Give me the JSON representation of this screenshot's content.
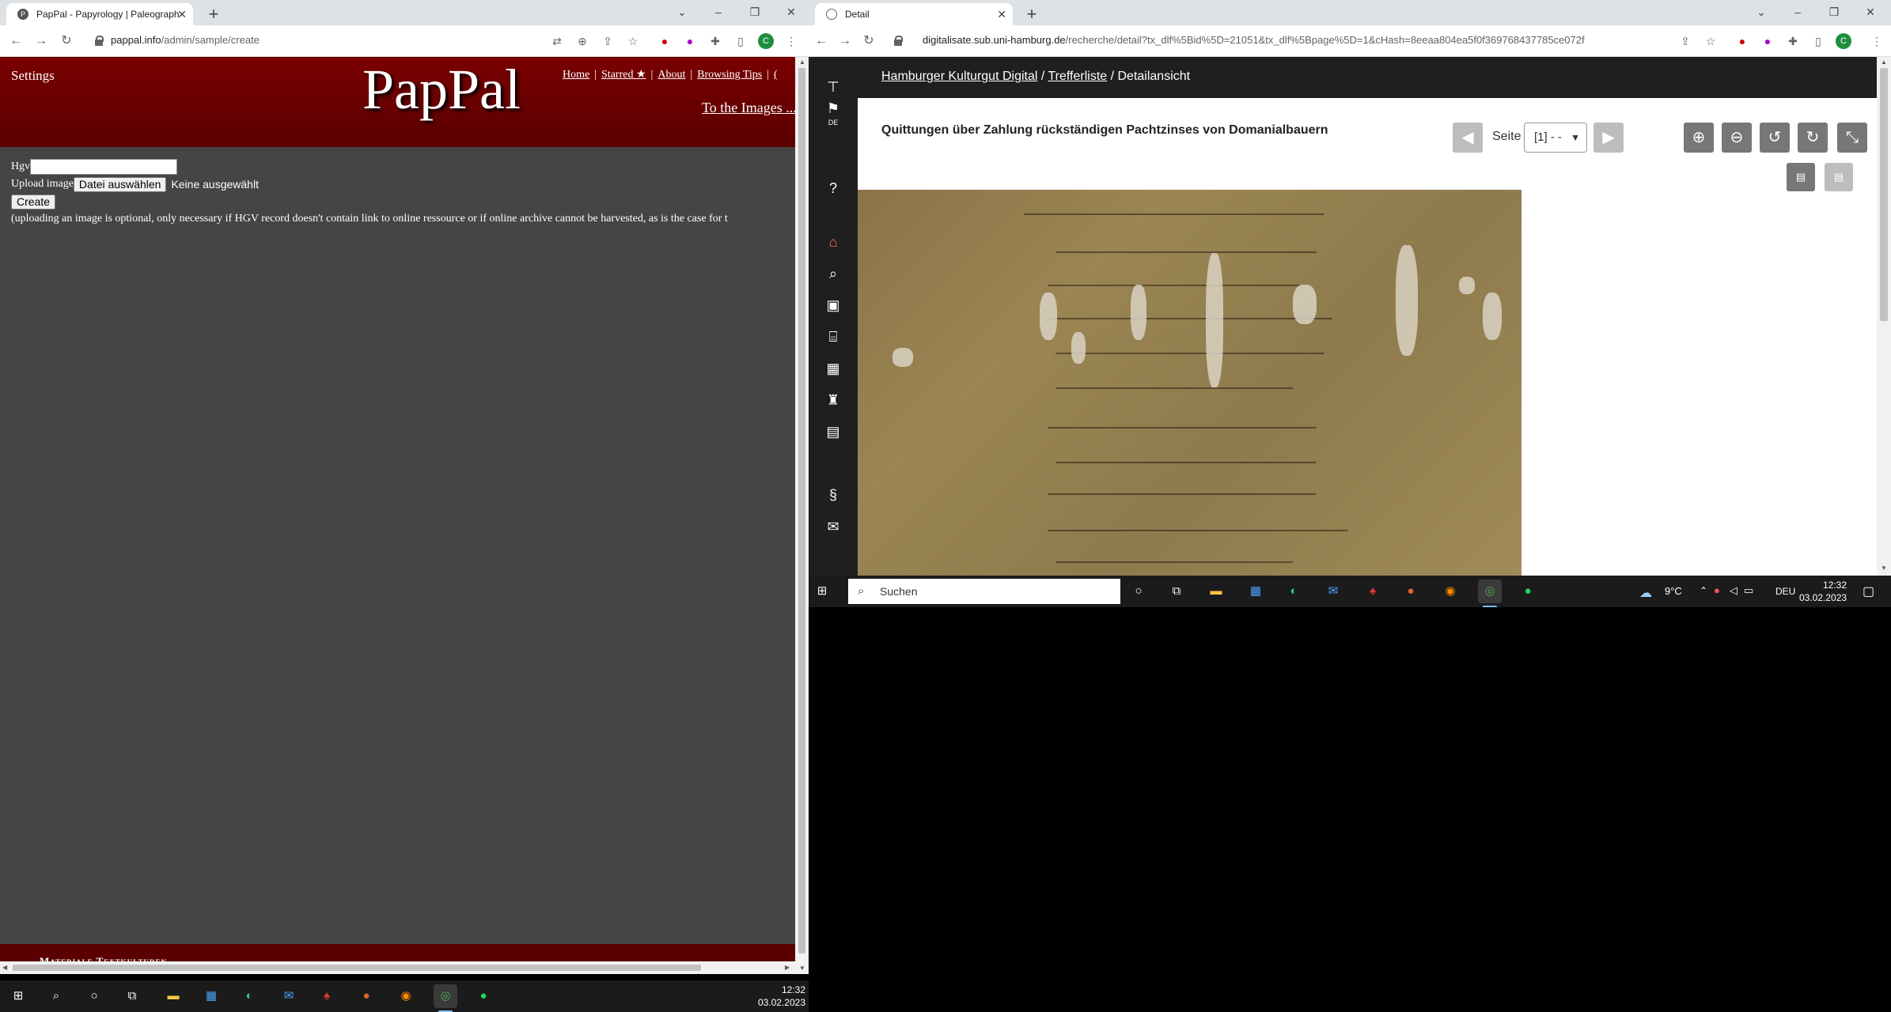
{
  "left_browser": {
    "tab_title": "PapPal - Papyrology | Paleograph",
    "favicon_letter": "P",
    "url_domain": "pappal.info",
    "url_path": "/admin/sample/create",
    "avatar_letter": "C"
  },
  "pappal": {
    "settings": "Settings",
    "logo": "PapPal",
    "nav": {
      "home": "Home",
      "starred": "Starred ★",
      "about": "About",
      "browsing_tips": "Browsing Tips",
      "sep": "|",
      "trunc": "("
    },
    "to_images": "To the Images ...",
    "form": {
      "hgv_label": "Hgv",
      "upload_label": "Upload image",
      "choose_file": "Datei auswählen",
      "no_file": "Keine ausgewählt",
      "create": "Create",
      "note": "(uploading an image is optional, only necessary if HGV record doesn't contain link to online ressource or if online archive cannot be harvested, as is the case for t"
    },
    "footer": "Materiale Textkulturen"
  },
  "left_taskbar": {
    "time": "12:32",
    "date": "03.02.2023"
  },
  "right_browser": {
    "tab_title": "Detail",
    "url_domain": "digitalisate.sub.uni-hamburg.de",
    "url_path": "/recherche/detail?tx_dlf%5Bid%5D=21051&tx_dlf%5Bpage%5D=1&cHash=8eeaa804ea5f0f369768437785ce072f",
    "avatar_letter": "C"
  },
  "hkd": {
    "breadcrumb": {
      "home": "Hamburger Kulturgut Digital",
      "sep1": " / ",
      "results": "Trefferliste",
      "sep2": " / ",
      "current": "Detailansicht"
    },
    "title": "Quittungen über Zahlung rückständigen Pachtzinses von Domanialbauern",
    "seite_label": "Seite",
    "seite_value": "[1] - -",
    "lang": "DE"
  },
  "right_taskbar": {
    "search_placeholder": "Suchen",
    "weather": "9°C",
    "lang": "DEU",
    "time": "12:32",
    "date": "03.02.2023"
  }
}
